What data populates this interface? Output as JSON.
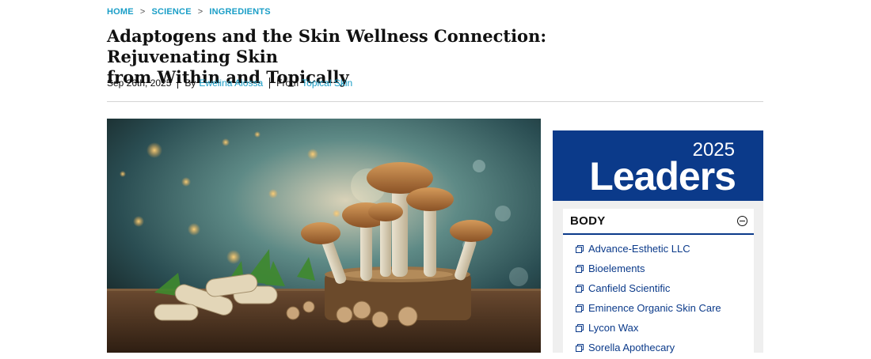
{
  "breadcrumb": {
    "home": "HOME",
    "science": "SCIENCE",
    "ingredients": "INGREDIENTS",
    "separator": ">"
  },
  "article": {
    "title_line1": "Adaptogens and the Skin Wellness Connection: Rejuvenating Skin",
    "title_line2": "from Within and Topically",
    "date": "Sep 26th, 2025",
    "by_label": "By",
    "author": "Ewelina Aiossa",
    "from_label": "From",
    "source": "Topical Skin",
    "image_icon": "mushroom-hero-image"
  },
  "sidebar": {
    "leaders_year": "2025",
    "leaders_title": "Leaders",
    "section_title": "BODY",
    "items": [
      {
        "label": "Advance-Esthetic LLC"
      },
      {
        "label": "Bioelements"
      },
      {
        "label": "Canfield Scientific"
      },
      {
        "label": "Eminence Organic Skin Care"
      },
      {
        "label": "Lycon Wax"
      },
      {
        "label": "Sorella Apothecary"
      }
    ]
  },
  "colors": {
    "accent": "#1a9ec7",
    "brand": "#0b3a8a"
  }
}
